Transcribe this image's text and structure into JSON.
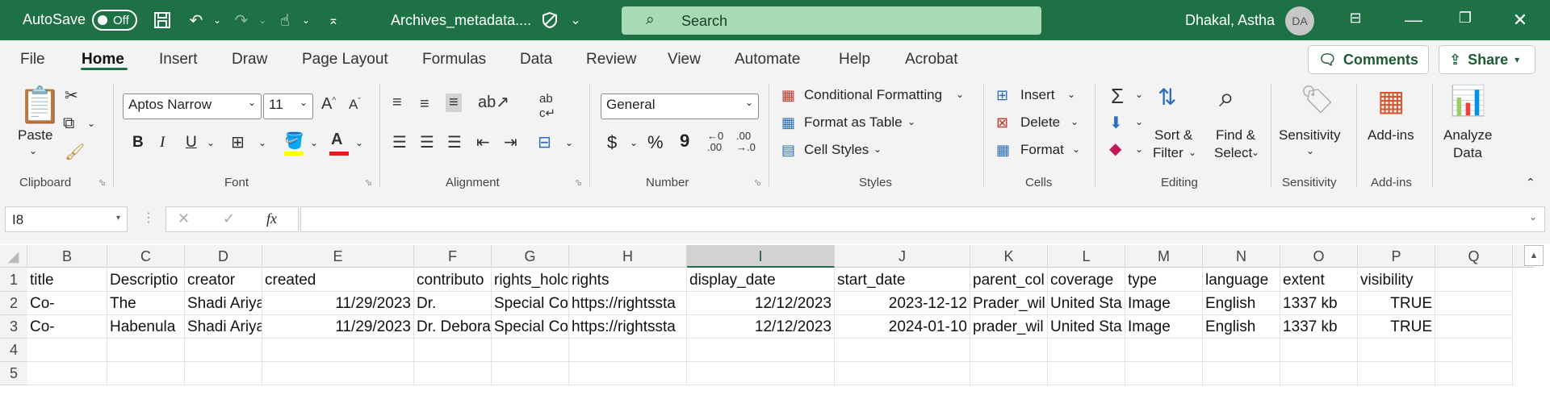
{
  "titlebar": {
    "autosave_label": "AutoSave",
    "autosave_state": "Off",
    "filename": "Archives_metadata....",
    "search_placeholder": "Search",
    "user_name": "Dhakal, Astha",
    "user_initials": "DA"
  },
  "menu": {
    "items": [
      "File",
      "Home",
      "Insert",
      "Draw",
      "Page Layout",
      "Formulas",
      "Data",
      "Review",
      "View",
      "Automate",
      "Help",
      "Acrobat"
    ],
    "active": "Home",
    "comments_label": "Comments",
    "share_label": "Share"
  },
  "ribbon": {
    "clipboard": {
      "paste_label": "Paste",
      "group_label": "Clipboard"
    },
    "font": {
      "font_name": "Aptos Narrow",
      "font_size": "11",
      "bold": "B",
      "italic": "I",
      "underline": "U",
      "group_label": "Font"
    },
    "alignment": {
      "group_label": "Alignment"
    },
    "number": {
      "format": "General",
      "currency": "$",
      "percent": "%",
      "comma": "9",
      "inc_dec": "←0\n.00",
      "dec_dec": ".00\n→.0",
      "group_label": "Number"
    },
    "styles": {
      "conditional": "Conditional Formatting",
      "format_table": "Format as Table",
      "cell_styles": "Cell Styles",
      "group_label": "Styles"
    },
    "cells": {
      "insert": "Insert",
      "delete": "Delete",
      "format": "Format",
      "group_label": "Cells"
    },
    "editing": {
      "sort_filter_1": "Sort &",
      "sort_filter_2": "Filter",
      "find_select_1": "Find &",
      "find_select_2": "Select",
      "group_label": "Editing"
    },
    "sensitivity": {
      "label": "Sensitivity",
      "group_label": "Sensitivity"
    },
    "addins": {
      "label": "Add-ins",
      "group_label": "Add-ins"
    },
    "analyze": {
      "label_1": "Analyze",
      "label_2": "Data"
    }
  },
  "formula_bar": {
    "name_box": "I8",
    "fx": "fx",
    "formula": ""
  },
  "sheet": {
    "columns": [
      "B",
      "C",
      "D",
      "E",
      "F",
      "G",
      "H",
      "I",
      "J",
      "K",
      "L",
      "M",
      "N",
      "O",
      "P",
      "Q"
    ],
    "selected_column": "I",
    "row_numbers": [
      "1",
      "2",
      "3",
      "4",
      "5"
    ],
    "rows": [
      [
        "title",
        "Descriptio",
        "creator",
        "created",
        "contributo",
        "rights_holc",
        "rights",
        "display_date",
        "start_date",
        "parent_col",
        "coverage",
        "type",
        "language",
        "extent",
        "visibility",
        ""
      ],
      [
        "Co-",
        "The",
        "Shadi Ariya",
        "11/29/2023",
        "Dr.",
        "Special Co",
        "https://rightssta",
        "12/12/2023",
        "2023-12-12",
        "Prader_wil",
        "United Sta",
        "Image",
        "English",
        "1337 kb",
        "TRUE",
        ""
      ],
      [
        "Co-",
        "Habenula",
        "Shadi Ariya",
        "11/29/2023",
        "Dr. Debora",
        "Special Co",
        "https://rightssta",
        "12/12/2023",
        "2024-01-10",
        "prader_wil",
        "United Sta",
        "Image",
        "English",
        "1337 kb",
        "TRUE",
        ""
      ],
      [
        "",
        "",
        "",
        "",
        "",
        "",
        "",
        "",
        "",
        "",
        "",
        "",
        "",
        "",
        "",
        ""
      ],
      [
        "",
        "",
        "",
        "",
        "",
        "",
        "",
        "",
        "",
        "",
        "",
        "",
        "",
        "",
        "",
        ""
      ]
    ]
  }
}
